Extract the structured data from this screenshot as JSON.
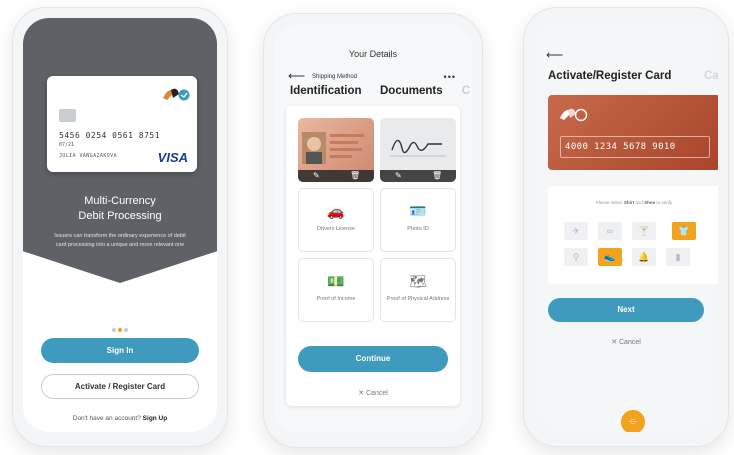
{
  "phone1": {
    "card": {
      "number": "5456 0254 0561 8751",
      "expiry": "07/21",
      "name": "JULIA VANGAZAKOVA",
      "network": "VISA"
    },
    "title_line1": "Multi-Currency",
    "title_line2": "Debit Processing",
    "body": "Issuers can transform the ordinary experience of debit card processing into a unique and more relevant one",
    "sign_in": "Sign In",
    "activate": "Activate / Register Card",
    "footer_text": "Don't have an account?",
    "footer_link": "Sign Up"
  },
  "phone2": {
    "header": "Your Details",
    "step": "Shipping Method",
    "more": "•••",
    "tabs": [
      "Identification",
      "Documents",
      "C"
    ],
    "docs": [
      "Drivers License",
      "Photo ID",
      "Proof of Income",
      "Proof of Physical Address"
    ],
    "continue": "Continue",
    "cancel": "✕  Cancel"
  },
  "phone3": {
    "title": "Activate/Register Card",
    "title_next": "Card",
    "card_number": "4000 1234 5678 9010",
    "hint_prefix": "Please select",
    "hint_a": "Shirt",
    "hint_mid": "and",
    "hint_b": "Shoe",
    "hint_suffix": "to verify",
    "next": "Next",
    "cancel": "✕  Cancel"
  },
  "colors": {
    "accent": "#3e9bbd",
    "highlight": "#f2a21c",
    "hero": "#5e6166",
    "card_red": "#b5523a"
  }
}
